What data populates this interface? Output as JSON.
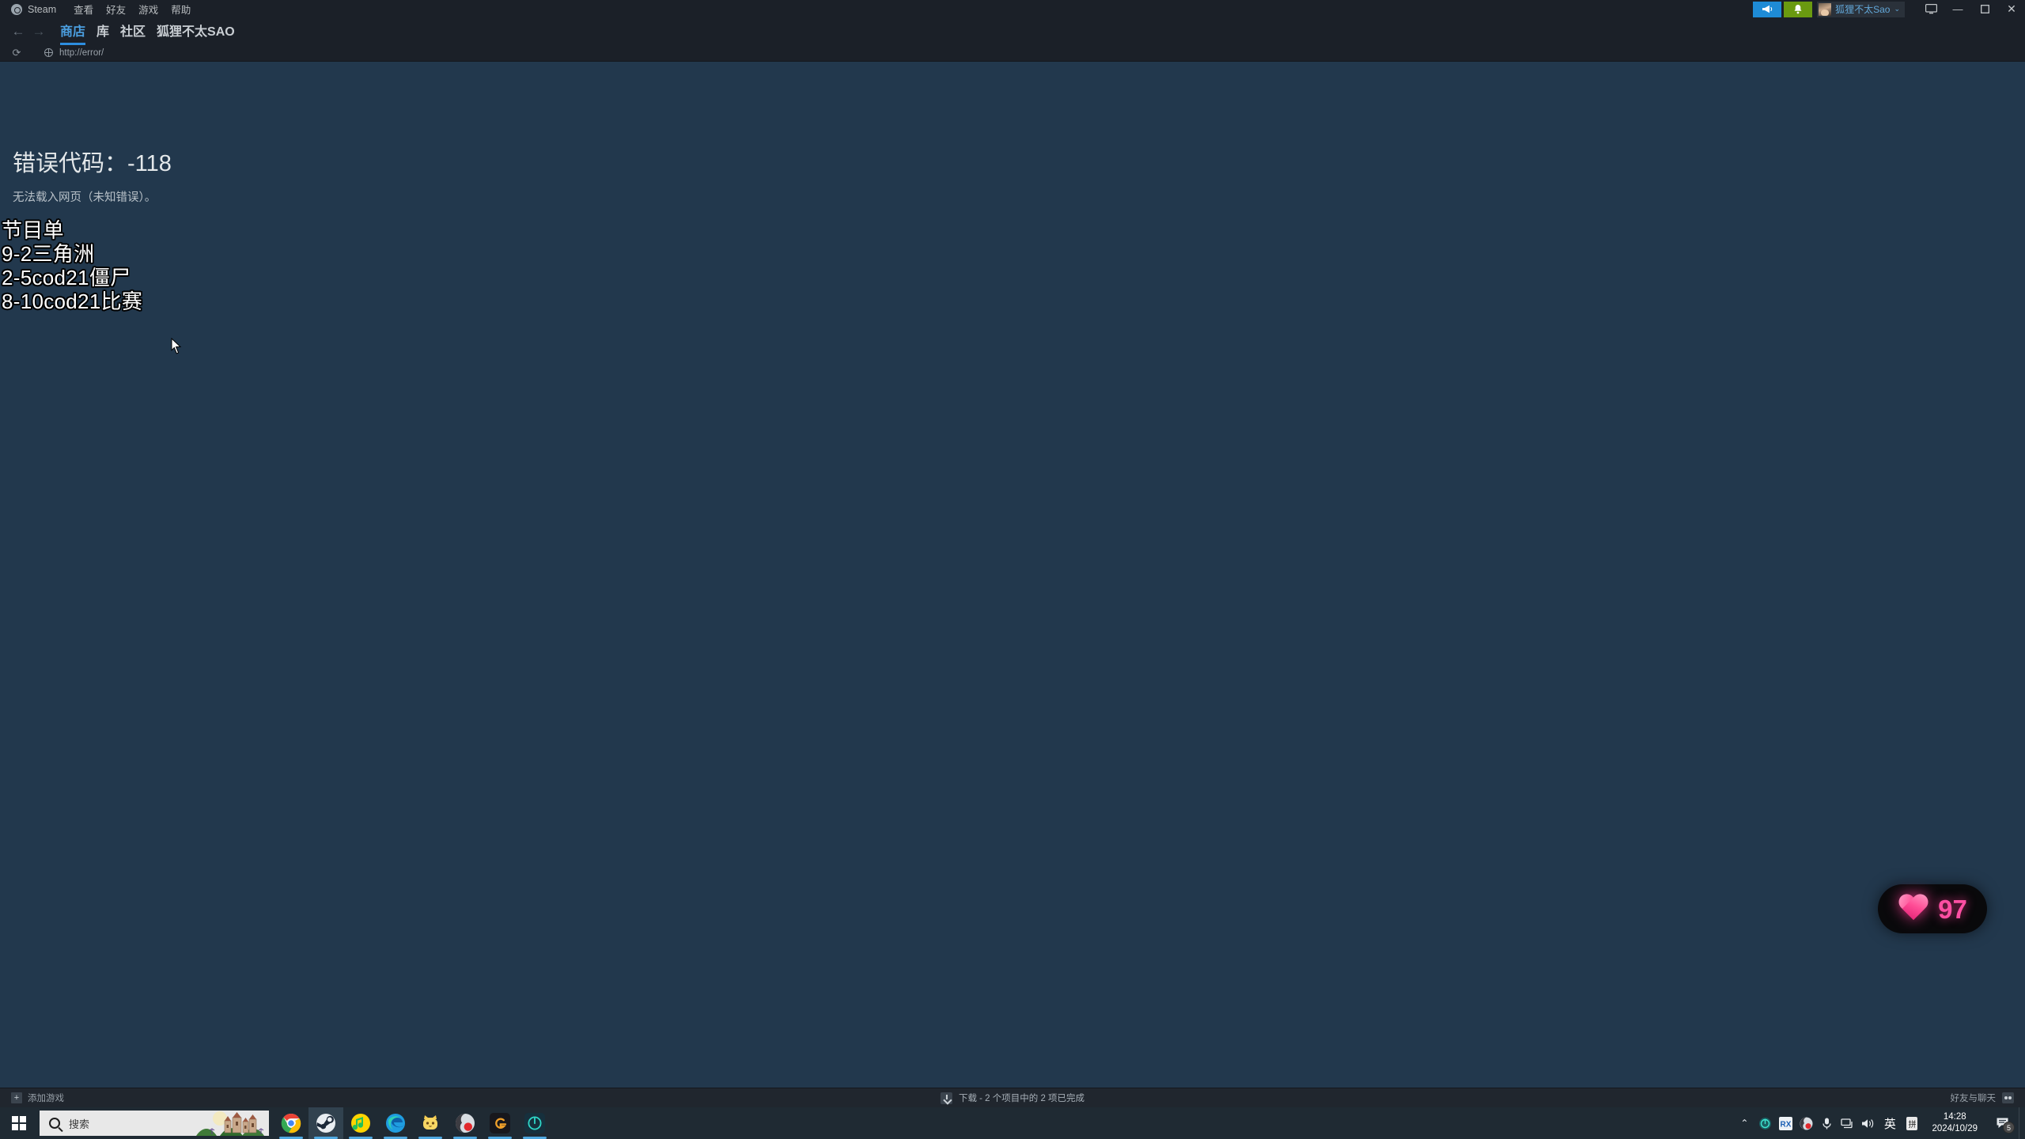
{
  "steam": {
    "menubar": {
      "logo_icon": "steam-logo-icon",
      "items": [
        {
          "label": "Steam"
        },
        {
          "label": "查看"
        },
        {
          "label": "好友"
        },
        {
          "label": "游戏"
        },
        {
          "label": "帮助"
        }
      ],
      "broadcast_icon": "megaphone-icon",
      "notify_icon": "bell-icon",
      "user": {
        "name": "狐狸不太Sao",
        "caret": "⌄",
        "avatar_icon": "user-avatar"
      },
      "window_controls": {
        "screen_icon": "monitor-icon",
        "minimize": "—",
        "maximize": "❐",
        "close": "✕"
      }
    },
    "nav": {
      "back_icon": "arrow-left-icon",
      "forward_icon": "arrow-right-icon",
      "tabs": [
        {
          "label": "商店",
          "active": true
        },
        {
          "label": "库",
          "active": false
        },
        {
          "label": "社区",
          "active": false
        },
        {
          "label": "狐狸不太SAO",
          "active": false
        }
      ]
    },
    "urlbar": {
      "reload_icon": "reload-icon",
      "globe_icon": "globe-icon",
      "url": "http://error/"
    },
    "page": {
      "background_color": "#22384d",
      "error_title": "错误代码：-118",
      "error_subtitle": "无法载入网页（未知错误）。",
      "overlay_lines": [
        "节目单",
        "9-2三角洲",
        "2-5cod21僵尸",
        "8-10cod21比赛"
      ]
    },
    "heart_widget": {
      "icon": "heart-icon",
      "count": "97",
      "accent_color": "#ff4fa3"
    },
    "statusbar": {
      "add_game": {
        "icon": "plus-icon",
        "label": "添加游戏"
      },
      "download": {
        "icon": "download-icon",
        "label": "下载 - 2 个项目中的 2 项已完成"
      },
      "friends": {
        "label": "好友与聊天",
        "icon": "friends-icon"
      }
    }
  },
  "taskbar": {
    "start_icon": "windows-logo-icon",
    "search": {
      "icon": "search-icon",
      "placeholder": "搜索",
      "illustration": "castle-icon"
    },
    "apps": [
      {
        "name": "chrome-icon",
        "active": false,
        "running": true
      },
      {
        "name": "steam-icon",
        "active": true,
        "running": true
      },
      {
        "name": "music-icon",
        "active": false,
        "running": true
      },
      {
        "name": "edge-icon",
        "active": false,
        "running": true
      },
      {
        "name": "cat-app-icon",
        "active": false,
        "running": true
      },
      {
        "name": "obs-icon",
        "active": false,
        "running": true
      },
      {
        "name": "game-launcher-icon",
        "active": false,
        "running": true
      },
      {
        "name": "teal-app-icon",
        "active": false,
        "running": true
      }
    ],
    "tray": {
      "chevron": "⌃",
      "icons": [
        "teal-tray-icon",
        "rx-tray-icon",
        "obs-tray-icon",
        "microphone-icon",
        "network-icon",
        "volume-icon"
      ],
      "ime_label": "英",
      "pinyin_label": "拼",
      "clock": {
        "time": "14:28",
        "date": "2024/10/29"
      },
      "notification": {
        "icon": "notification-icon",
        "count": "5"
      }
    }
  }
}
